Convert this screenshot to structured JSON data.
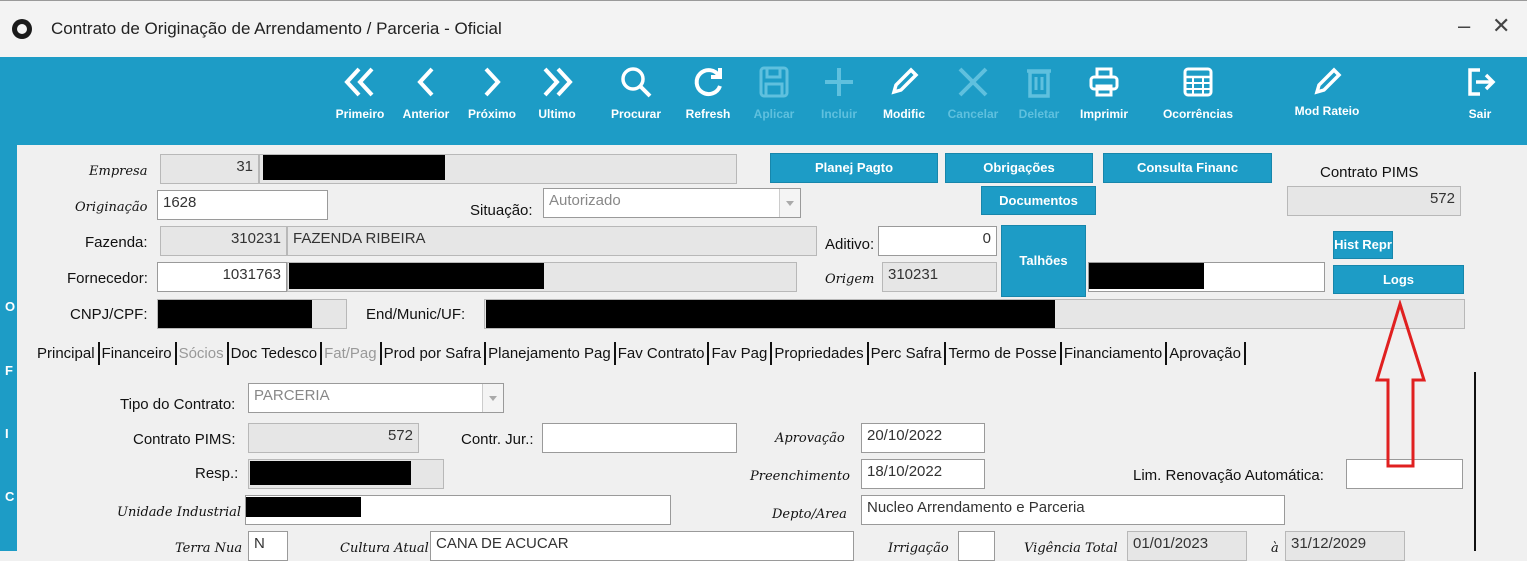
{
  "window": {
    "title": "Contrato de Originação de Arrendamento / Parceria - Oficial",
    "minimize": "–",
    "close": "✕"
  },
  "toolbar": {
    "primeiro": "Primeiro",
    "anterior": "Anterior",
    "proximo": "Próximo",
    "ultimo": "Ultimo",
    "procurar": "Procurar",
    "refresh": "Refresh",
    "aplicar": "Aplicar",
    "incluir": "Incluir",
    "modific": "Modific",
    "cancelar": "Cancelar",
    "deletar": "Deletar",
    "imprimir": "Imprimir",
    "ocorrencias": "Ocorrências",
    "mod_rateio": "Mod Rateio",
    "sair": "Sair"
  },
  "sidebar": {
    "letters": [
      "O",
      "F",
      "I",
      "C"
    ]
  },
  "header": {
    "empresa_label": "Empresa",
    "empresa_code": "31",
    "originacao_label": "Originação",
    "originacao_value": "1628",
    "situacao_label": "Situação:",
    "situacao_value": "Autorizado",
    "fazenda_label": "Fazenda:",
    "fazenda_code": "310231",
    "fazenda_name": "FAZENDA RIBEIRA",
    "aditivo_label": "Aditivo:",
    "aditivo_value": "0",
    "fornecedor_label": "Fornecedor:",
    "fornecedor_code": "1031763",
    "origem_label": "Origem",
    "origem_value": "310231",
    "cnpj_label": "CNPJ/CPF:",
    "endmunic_label": "End/Munic/UF:",
    "contrato_pims_label": "Contrato PIMS",
    "contrato_pims_value": "572"
  },
  "buttons": {
    "planej_pagto": "Planej Pagto",
    "obrigacoes": "Obrigações",
    "consulta_financ": "Consulta Financ",
    "documentos": "Documentos",
    "talhoes": "Talhões",
    "hist_repr": "Hist Repr",
    "logs": "Logs"
  },
  "tabs": [
    "Principal",
    "Financeiro",
    "Sócios",
    "Doc Tedesco",
    "Fat/Pag",
    "Prod por Safra",
    "Planejamento Pag",
    "Fav Contrato",
    "Fav Pag",
    "Propriedades",
    "Perc Safra",
    "Termo de Posse",
    "Financiamento",
    "Aprovação"
  ],
  "tabs_disabled": [
    "Sócios",
    "Fat/Pag"
  ],
  "principal": {
    "tipo_label": "Tipo do Contrato:",
    "tipo_value": "PARCERIA",
    "contrato_pims_label": "Contrato PIMS:",
    "contrato_pims_value": "572",
    "contr_jur_label": "Contr. Jur.:",
    "contr_jur_value": "",
    "aprovacao_label": "Aprovação",
    "aprovacao_value": "20/10/2022",
    "resp_label": "Resp.:",
    "preenchimento_label": "Preenchimento",
    "preenchimento_value": "18/10/2022",
    "lim_renov_label": "Lim. Renovação Automática:",
    "lim_renov_value": "",
    "unidade_label": "Unidade Industrial",
    "depto_label": "Depto/Area",
    "depto_value": "Nucleo Arrendamento e Parceria",
    "terra_nua_label": "Terra Nua",
    "terra_nua_value": "N",
    "cultura_label": "Cultura Atual",
    "cultura_value": "CANA DE ACUCAR",
    "irrigacao_label": "Irrigação",
    "irrigacao_value": "",
    "vigencia_label": "Vigência Total",
    "vigencia_start": "01/01/2023",
    "vigencia_sep": "à",
    "vigencia_end": "31/12/2029"
  },
  "colors": {
    "toolbar": "#1d9cc6",
    "annotation_arrow": "#e02020"
  }
}
